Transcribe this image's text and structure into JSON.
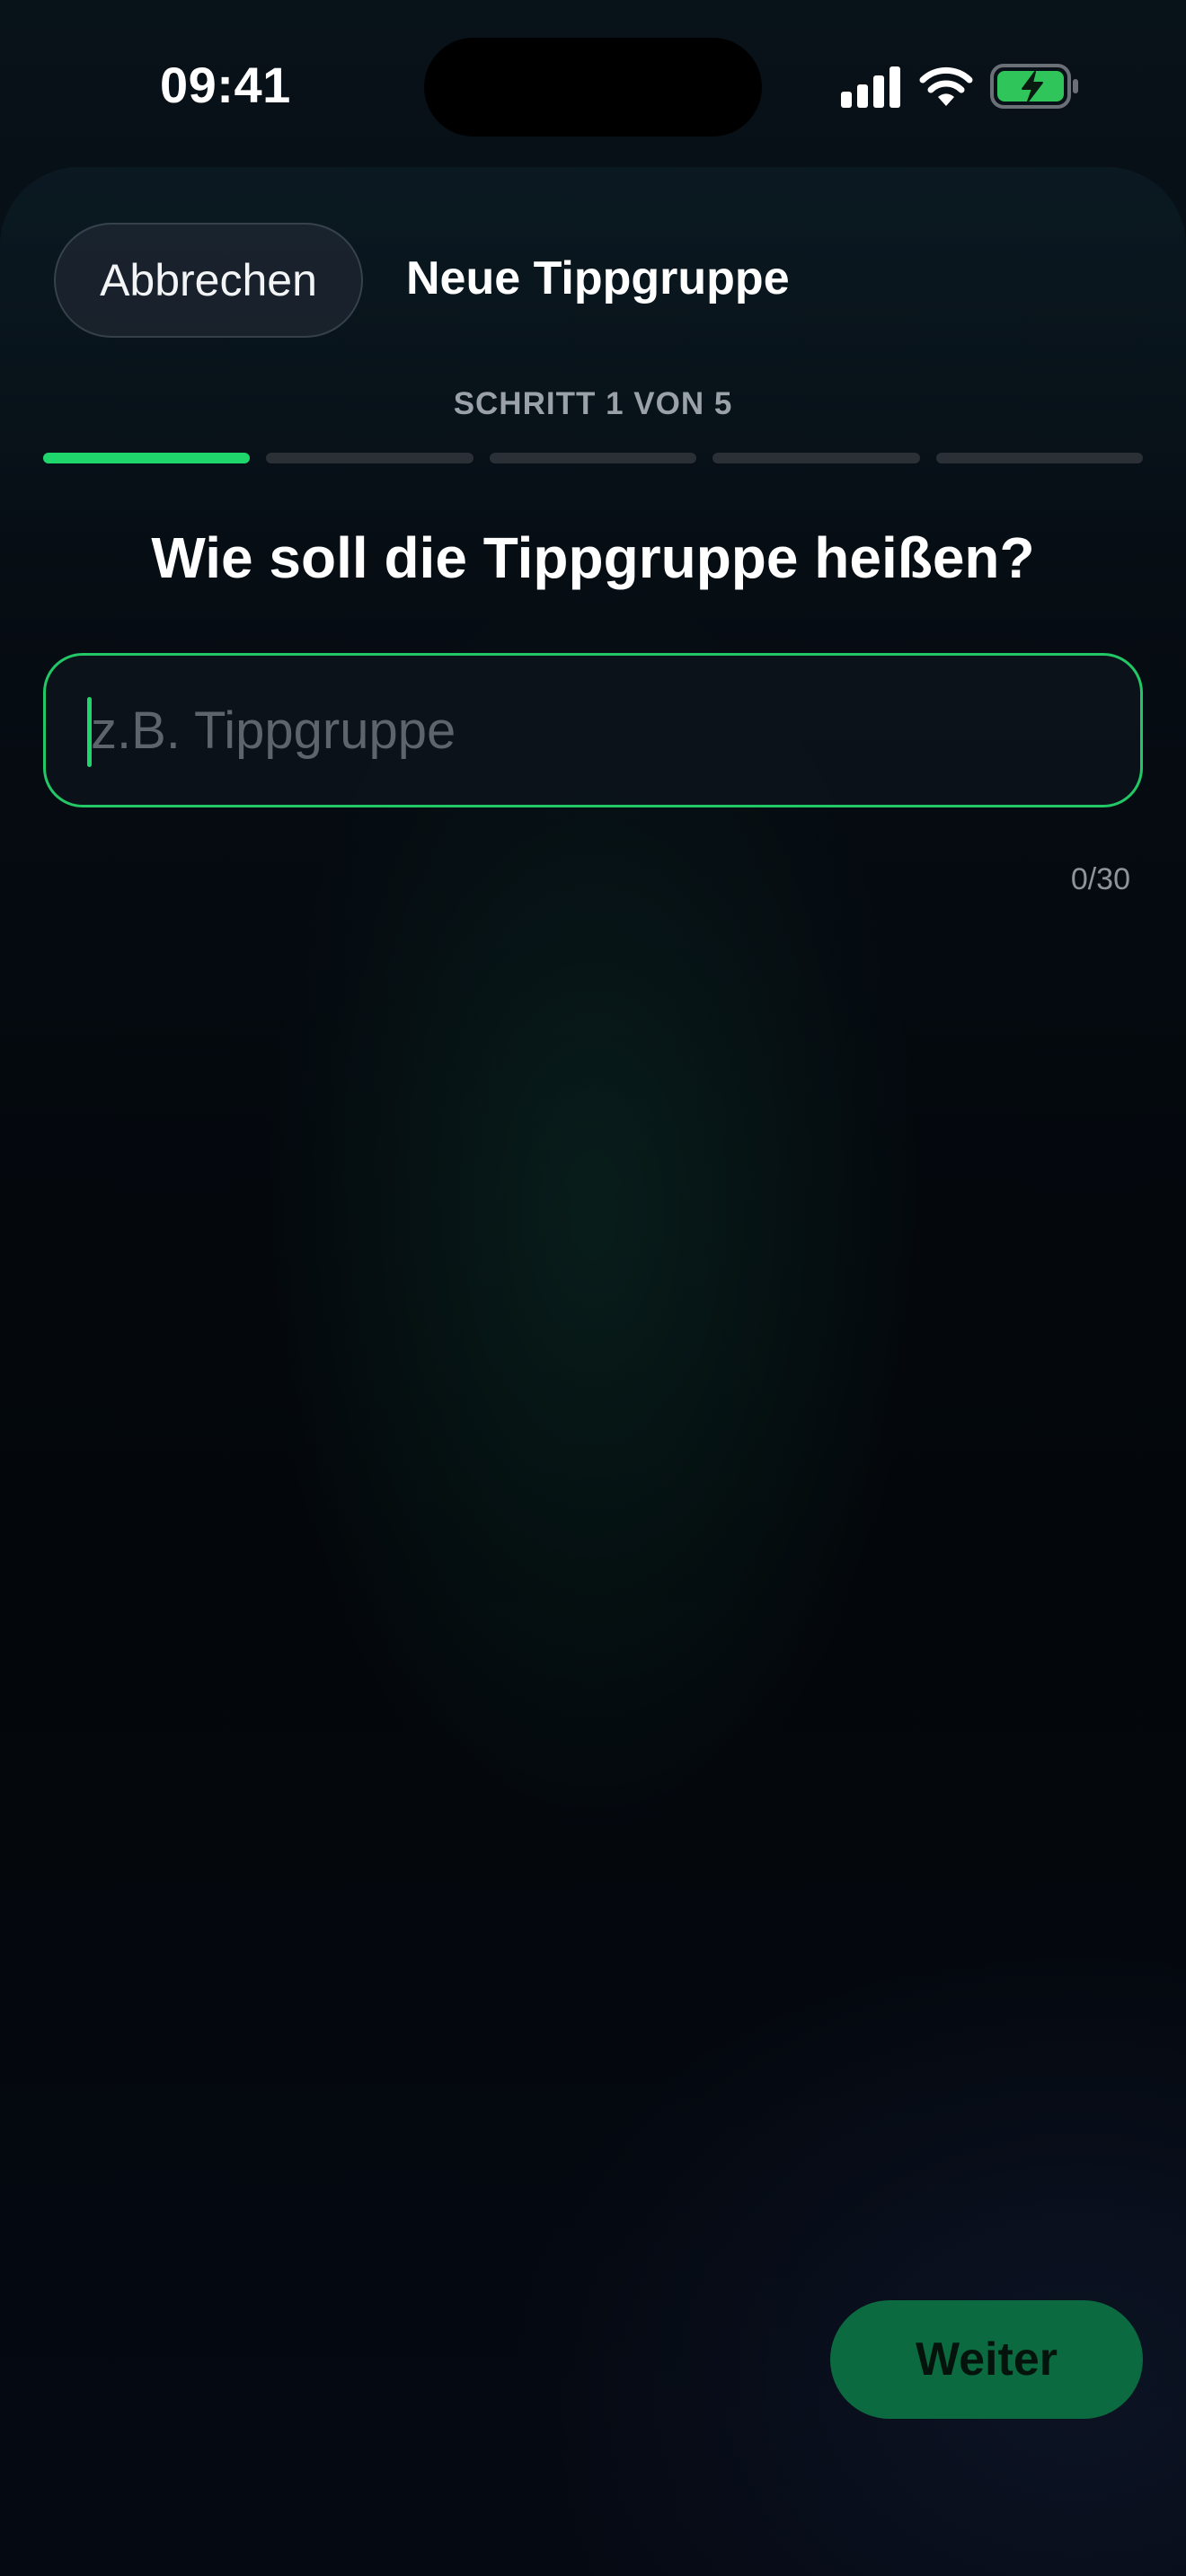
{
  "status_bar": {
    "time": "09:41",
    "icons": [
      "signal-icon",
      "wifi-icon",
      "battery-charging-icon"
    ]
  },
  "header": {
    "cancel_label": "Abbrechen",
    "title": "Neue Tippgruppe"
  },
  "stepper": {
    "label": "SCHRITT 1 VON 5",
    "current_step": 1,
    "total_steps": 5
  },
  "question": "Wie soll die Tippgruppe heißen?",
  "name_input": {
    "value": "",
    "placeholder": "z.B. Tippgruppe",
    "counter": "0/30"
  },
  "footer": {
    "next_label": "Weiter"
  },
  "colors": {
    "accent": "#1fd66c",
    "next_button_bg": "#0c6a40",
    "background": "#03070b"
  }
}
